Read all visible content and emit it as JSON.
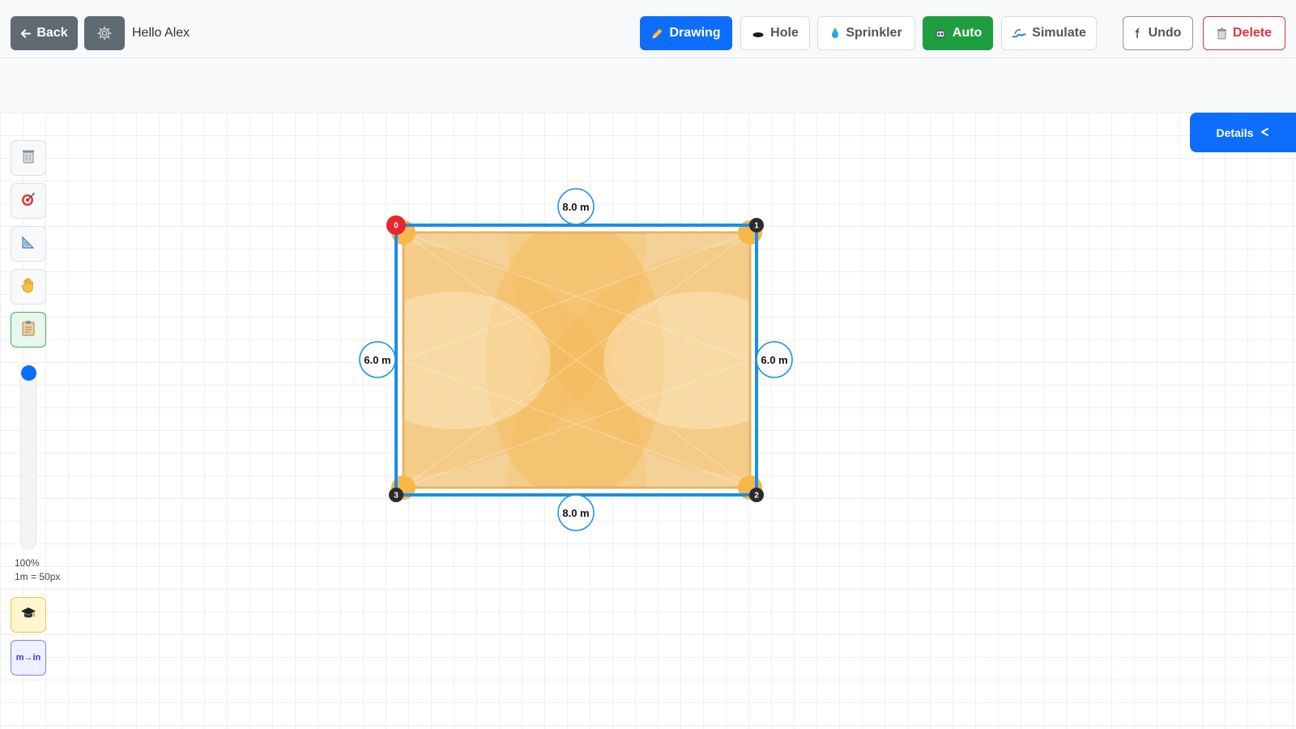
{
  "header": {
    "back_label": "Back",
    "greeting": "Hello Alex",
    "modes": {
      "drawing": "Drawing",
      "hole": "Hole",
      "sprinkler": "Sprinkler",
      "auto": "Auto",
      "simulate": "Simulate"
    },
    "undo_label": "Undo",
    "delete_label": "Delete"
  },
  "details_panel": {
    "label": "Details"
  },
  "zoom": {
    "level": "100%",
    "scale": "1m = 50px"
  },
  "unit_toggle": {
    "label": "m→in"
  },
  "area": {
    "edges": {
      "top": "8.0 m",
      "right": "6.0 m",
      "bottom": "8.0 m",
      "left": "6.0 m"
    },
    "vertices": [
      "0",
      "1",
      "2",
      "3"
    ]
  },
  "colors": {
    "primary": "#0d6efd",
    "success": "#1e9e3e",
    "danger": "#dc3545",
    "coverage": "#f5b041",
    "outline": "#1a8ee8",
    "vertex_start": "#e8262e",
    "vertex": "#2b2b2b"
  }
}
